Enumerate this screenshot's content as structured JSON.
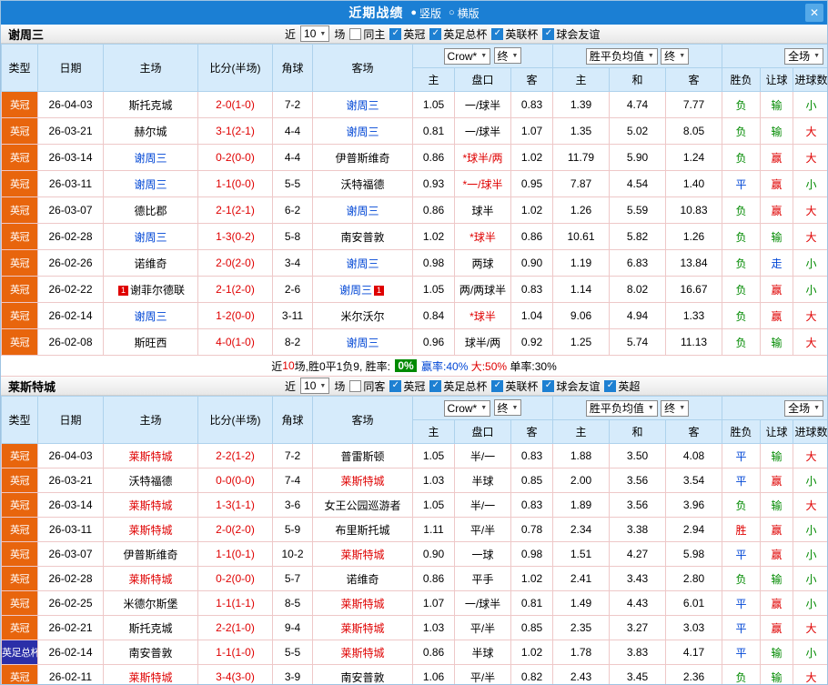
{
  "titlebar": {
    "title": "近期战绩",
    "vertical_label": "竖版",
    "horizontal_label": "横版"
  },
  "icons": {
    "close": "✕",
    "radio_selected": "●",
    "radio_unselected": "○",
    "caret": "▼",
    "check": "✓"
  },
  "colors": {
    "titlebar_bg": "#1b7fd4",
    "header_bg": "#d6ebfb",
    "red": "#df0000",
    "blue": "#0046d5",
    "green": "#008a00",
    "checkbox_blue": "#1e80d2"
  },
  "league_colors": {
    "英冠": "#e8650d",
    "英足总杯": "#2b2fa8"
  },
  "value_colors": {
    "胜": "#df0000",
    "平": "#0046d5",
    "负": "#008a00",
    "赢": "#df0000",
    "走": "#0046d5",
    "输": "#008a00",
    "大": "#df0000",
    "小": "#008a00"
  },
  "filters": {
    "near_label": "近",
    "rounds": "10",
    "games_label": "场"
  },
  "table_header": {
    "type": "类型",
    "date": "日期",
    "home": "主场",
    "score": "比分(半场)",
    "corner": "角球",
    "away": "客场",
    "bookmaker": "Crow*",
    "final": "终",
    "odds_avg": "胜平负均值",
    "final2": "终",
    "scope": "全场",
    "h": "主",
    "handicap": "盘口",
    "a": "客",
    "o_home": "主",
    "o_draw": "和",
    "o_away": "客",
    "result": "胜负",
    "let_result": "让球",
    "goals": "进球数"
  },
  "sections": [
    {
      "team": "谢周三",
      "team_color": "#0046d5",
      "same_label": "同主",
      "leagues": [
        "英冠",
        "英足总杯",
        "英联杯",
        "球会友谊"
      ],
      "rows": [
        {
          "lg": "英冠",
          "date": "26-04-03",
          "home": "斯托克城",
          "score": "2-0(1-0)",
          "corner": "7-2",
          "away": "谢周三",
          "h": "1.05",
          "hc": "一/球半",
          "a": "0.83",
          "o1": "1.39",
          "o2": "4.74",
          "o3": "7.77",
          "res": "负",
          "let": "输",
          "goal": "小"
        },
        {
          "lg": "英冠",
          "date": "26-03-21",
          "home": "赫尔城",
          "score": "3-1(2-1)",
          "corner": "4-4",
          "away": "谢周三",
          "h": "0.81",
          "hc": "一/球半",
          "a": "1.07",
          "o1": "1.35",
          "o2": "5.02",
          "o3": "8.05",
          "res": "负",
          "let": "输",
          "goal": "大"
        },
        {
          "lg": "英冠",
          "date": "26-03-14",
          "home": "谢周三",
          "score": "0-2(0-0)",
          "corner": "4-4",
          "away": "伊普斯维奇",
          "h": "0.86",
          "hc": "*球半/两",
          "a": "1.02",
          "o1": "11.79",
          "o2": "5.90",
          "o3": "1.24",
          "res": "负",
          "let": "赢",
          "goal": "大"
        },
        {
          "lg": "英冠",
          "date": "26-03-11",
          "home": "谢周三",
          "score": "1-1(0-0)",
          "corner": "5-5",
          "away": "沃特福德",
          "h": "0.93",
          "hc": "*一/球半",
          "a": "0.95",
          "o1": "7.87",
          "o2": "4.54",
          "o3": "1.40",
          "res": "平",
          "let": "赢",
          "goal": "小"
        },
        {
          "lg": "英冠",
          "date": "26-03-07",
          "home": "德比郡",
          "score": "2-1(2-1)",
          "corner": "6-2",
          "away": "谢周三",
          "h": "0.86",
          "hc": "球半",
          "a": "1.02",
          "o1": "1.26",
          "o2": "5.59",
          "o3": "10.83",
          "res": "负",
          "let": "赢",
          "goal": "大"
        },
        {
          "lg": "英冠",
          "date": "26-02-28",
          "home": "谢周三",
          "score": "1-3(0-2)",
          "corner": "5-8",
          "away": "南安普敦",
          "h": "1.02",
          "hc": "*球半",
          "a": "0.86",
          "o1": "10.61",
          "o2": "5.82",
          "o3": "1.26",
          "res": "负",
          "let": "输",
          "goal": "大"
        },
        {
          "lg": "英冠",
          "date": "26-02-26",
          "home": "诺维奇",
          "score": "2-0(2-0)",
          "corner": "3-4",
          "away": "谢周三",
          "h": "0.98",
          "hc": "两球",
          "a": "0.90",
          "o1": "1.19",
          "o2": "6.83",
          "o3": "13.84",
          "res": "负",
          "let": "走",
          "goal": "小"
        },
        {
          "lg": "英冠",
          "date": "26-02-22",
          "home": "谢菲尔德联",
          "hb": "1",
          "score": "2-1(2-0)",
          "corner": "2-6",
          "away": "谢周三",
          "ab": "1",
          "h": "1.05",
          "hc": "两/两球半",
          "a": "0.83",
          "o1": "1.14",
          "o2": "8.02",
          "o3": "16.67",
          "res": "负",
          "let": "赢",
          "goal": "小"
        },
        {
          "lg": "英冠",
          "date": "26-02-14",
          "home": "谢周三",
          "score": "1-2(0-0)",
          "corner": "3-11",
          "away": "米尔沃尔",
          "h": "0.84",
          "hc": "*球半",
          "a": "1.04",
          "o1": "9.06",
          "o2": "4.94",
          "o3": "1.33",
          "res": "负",
          "let": "赢",
          "goal": "大"
        },
        {
          "lg": "英冠",
          "date": "26-02-08",
          "home": "斯旺西",
          "score": "4-0(1-0)",
          "corner": "8-2",
          "away": "谢周三",
          "h": "0.96",
          "hc": "球半/两",
          "a": "0.92",
          "o1": "1.25",
          "o2": "5.74",
          "o3": "11.13",
          "res": "负",
          "let": "输",
          "goal": "大"
        }
      ],
      "summary": [
        {
          "t": "近",
          "s": "plain"
        },
        {
          "t": "10",
          "s": "red"
        },
        {
          "t": "场,胜0平1负9, 胜率: ",
          "s": "plain"
        },
        {
          "t": "0%",
          "s": "badge"
        },
        {
          "t": " 赢率:40%",
          "s": "blue"
        },
        {
          "t": " 大:50%",
          "s": "red"
        },
        {
          "t": " 单率:30%",
          "s": "plain"
        }
      ]
    },
    {
      "team": "莱斯特城",
      "team_color": "#df0000",
      "same_label": "同客",
      "leagues": [
        "英冠",
        "英足总杯",
        "英联杯",
        "球会友谊",
        "英超"
      ],
      "rows": [
        {
          "lg": "英冠",
          "date": "26-04-03",
          "home": "莱斯特城",
          "score": "2-2(1-2)",
          "corner": "7-2",
          "away": "普雷斯顿",
          "h": "1.05",
          "hc": "半/一",
          "a": "0.83",
          "o1": "1.88",
          "o2": "3.50",
          "o3": "4.08",
          "res": "平",
          "let": "输",
          "goal": "大"
        },
        {
          "lg": "英冠",
          "date": "26-03-21",
          "home": "沃特福德",
          "score": "0-0(0-0)",
          "corner": "7-4",
          "away": "莱斯特城",
          "h": "1.03",
          "hc": "半球",
          "a": "0.85",
          "o1": "2.00",
          "o2": "3.56",
          "o3": "3.54",
          "res": "平",
          "let": "赢",
          "goal": "小"
        },
        {
          "lg": "英冠",
          "date": "26-03-14",
          "home": "莱斯特城",
          "score": "1-3(1-1)",
          "corner": "3-6",
          "away": "女王公园巡游者",
          "h": "1.05",
          "hc": "半/一",
          "a": "0.83",
          "o1": "1.89",
          "o2": "3.56",
          "o3": "3.96",
          "res": "负",
          "let": "输",
          "goal": "大"
        },
        {
          "lg": "英冠",
          "date": "26-03-11",
          "home": "莱斯特城",
          "score": "2-0(2-0)",
          "corner": "5-9",
          "away": "布里斯托城",
          "h": "1.11",
          "hc": "平/半",
          "a": "0.78",
          "o1": "2.34",
          "o2": "3.38",
          "o3": "2.94",
          "res": "胜",
          "let": "赢",
          "goal": "小"
        },
        {
          "lg": "英冠",
          "date": "26-03-07",
          "home": "伊普斯维奇",
          "score": "1-1(0-1)",
          "corner": "10-2",
          "away": "莱斯特城",
          "h": "0.90",
          "hc": "一球",
          "a": "0.98",
          "o1": "1.51",
          "o2": "4.27",
          "o3": "5.98",
          "res": "平",
          "let": "赢",
          "goal": "小"
        },
        {
          "lg": "英冠",
          "date": "26-02-28",
          "home": "莱斯特城",
          "score": "0-2(0-0)",
          "corner": "5-7",
          "away": "诺维奇",
          "h": "0.86",
          "hc": "平手",
          "a": "1.02",
          "o1": "2.41",
          "o2": "3.43",
          "o3": "2.80",
          "res": "负",
          "let": "输",
          "goal": "小"
        },
        {
          "lg": "英冠",
          "date": "26-02-25",
          "home": "米德尔斯堡",
          "score": "1-1(1-1)",
          "corner": "8-5",
          "away": "莱斯特城",
          "h": "1.07",
          "hc": "一/球半",
          "a": "0.81",
          "o1": "1.49",
          "o2": "4.43",
          "o3": "6.01",
          "res": "平",
          "let": "赢",
          "goal": "小"
        },
        {
          "lg": "英冠",
          "date": "26-02-21",
          "home": "斯托克城",
          "score": "2-2(1-0)",
          "corner": "9-4",
          "away": "莱斯特城",
          "h": "1.03",
          "hc": "平/半",
          "a": "0.85",
          "o1": "2.35",
          "o2": "3.27",
          "o3": "3.03",
          "res": "平",
          "let": "赢",
          "goal": "大"
        },
        {
          "lg": "英足总杯",
          "date": "26-02-14",
          "home": "南安普敦",
          "score": "1-1(1-0)",
          "corner": "5-5",
          "away": "莱斯特城",
          "h": "0.86",
          "hc": "半球",
          "a": "1.02",
          "o1": "1.78",
          "o2": "3.83",
          "o3": "4.17",
          "res": "平",
          "let": "输",
          "goal": "小"
        },
        {
          "lg": "英冠",
          "date": "26-02-11",
          "home": "莱斯特城",
          "score": "3-4(3-0)",
          "corner": "3-9",
          "away": "南安普敦",
          "h": "1.06",
          "hc": "平/半",
          "a": "0.82",
          "o1": "2.43",
          "o2": "3.45",
          "o3": "2.36",
          "res": "负",
          "let": "输",
          "goal": "大"
        }
      ]
    }
  ]
}
